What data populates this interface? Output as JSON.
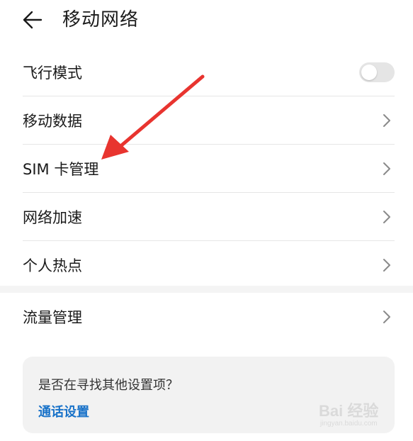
{
  "header": {
    "title": "移动网络",
    "back_icon": "arrow-left-icon"
  },
  "list": {
    "items": [
      {
        "label": "飞行模式",
        "control": "toggle",
        "toggle_on": false
      },
      {
        "label": "移动数据",
        "control": "chevron"
      },
      {
        "label": "SIM 卡管理",
        "control": "chevron"
      },
      {
        "label": "网络加速",
        "control": "chevron"
      },
      {
        "label": "个人热点",
        "control": "chevron"
      }
    ]
  },
  "list2": {
    "items": [
      {
        "label": "流量管理",
        "control": "chevron"
      }
    ]
  },
  "suggestion": {
    "question": "是否在寻找其他设置项？",
    "link": "通话设置"
  },
  "annotation": {
    "arrow_color": "#e8342f",
    "arrow_icon": "red-arrow-annotation"
  },
  "watermark": {
    "text": "Bai 经验",
    "sub": "jingyan.baidu.com"
  },
  "colors": {
    "link": "#1a73c9",
    "divider": "#e6e6e6",
    "card_bg": "#f2f2f2",
    "toggle_off": "#e5e5e5"
  }
}
